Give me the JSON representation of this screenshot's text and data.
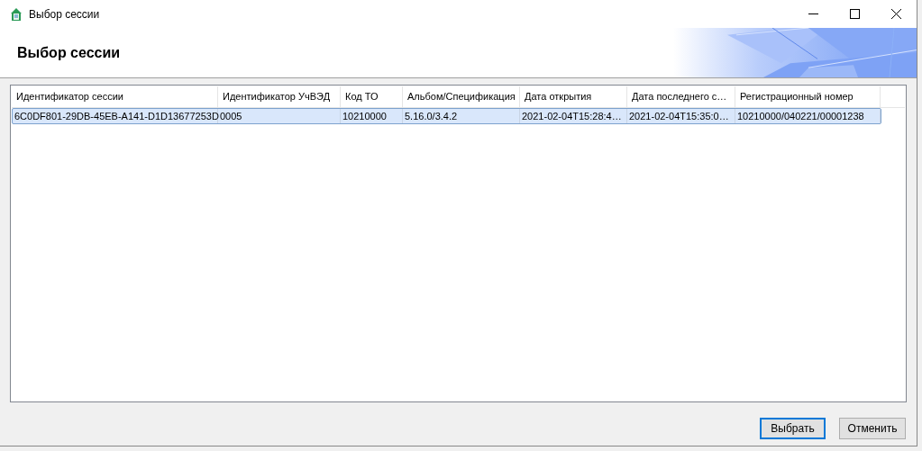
{
  "window": {
    "title": "Выбор сессии"
  },
  "header": {
    "title": "Выбор сессии"
  },
  "table": {
    "columns": [
      "Идентификатор сессии",
      "Идентификатор УчВЭД",
      "Код ТО",
      "Альбом/Спецификация",
      "Дата открытия",
      "Дата последнего с…",
      "Регистрационный номер"
    ],
    "rows": [
      {
        "selected": true,
        "cells": [
          "6C0DF801-29DB-45EB-A141-D1D13677253D",
          "0005",
          "10210000",
          "5.16.0/3.4.2",
          "2021-02-04T15:28:4…",
          "2021-02-04T15:35:0…",
          "10210000/040221/00001238"
        ]
      }
    ]
  },
  "buttons": [
    {
      "label": "Выбрать",
      "focused": true
    },
    {
      "label": "Отменить",
      "focused": false
    }
  ]
}
